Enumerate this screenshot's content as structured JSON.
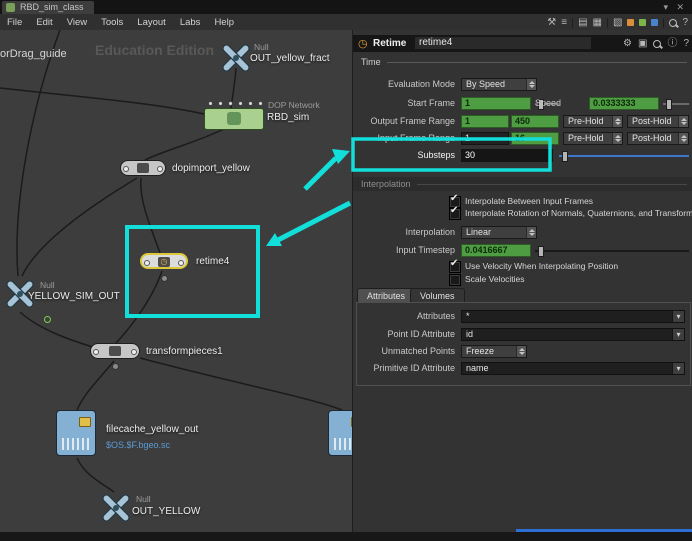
{
  "colors": {
    "highlight_cyan": "#12dfda",
    "keyframe_green": "#4f9d42",
    "slider_blue": "#3f76c9",
    "file_path_blue": "#5b9bd5",
    "dop_node_green": "#a9d08e"
  },
  "icons": {
    "clock": "◷",
    "gear": "⚙",
    "bookmark": "▣",
    "info": "ⓘ",
    "help": "?",
    "caret_down": "▾",
    "close": "✕",
    "check": "✔",
    "hammer": "⚒",
    "list": "≡",
    "grid": "▤",
    "grid2": "▦",
    "grid3": "▧"
  },
  "window": {
    "tab_title": "RBD_sim_class",
    "menus": [
      "File",
      "Edit",
      "View",
      "Tools",
      "Layout",
      "Labs",
      "Help"
    ]
  },
  "network": {
    "watermark": "Education Edition",
    "guide_label": "orDrag_guide",
    "nodes": {
      "out_yellow_fract": {
        "type": "Null",
        "name": "OUT_yellow_fract"
      },
      "rbd_sim": {
        "type": "DOP Network",
        "name": "RBD_sim"
      },
      "dopimport_yellow": {
        "name": "dopimport_yellow"
      },
      "retime": {
        "name": "retime4"
      },
      "yellow_sim_out": {
        "type": "Null",
        "name": "YELLOW_SIM_OUT"
      },
      "transformpieces": {
        "name": "transformpieces1"
      },
      "filecache": {
        "name": "filecache_yellow_out",
        "path": "$OS.$F.bgeo.sc"
      },
      "out_yellow": {
        "type": "Null",
        "name": "OUT_YELLOW"
      }
    }
  },
  "params": {
    "header": {
      "node_type": "Retime",
      "node_name": "retime4"
    },
    "time": {
      "title": "Time",
      "evaluation_mode_label": "Evaluation Mode",
      "evaluation_mode_value": "By Speed",
      "start_frame_label": "Start Frame",
      "start_frame_value": "1",
      "speed_label": "Speed",
      "speed_value": "0.0333333",
      "output_range_label": "Output Frame Range",
      "output_start": "1",
      "output_end": "450",
      "pre_hold_label": "Pre-Hold",
      "post_hold_label": "Post-Hold",
      "input_range_label": "Input Frame Range",
      "input_start": "1",
      "input_end": "16",
      "substeps_label": "Substeps",
      "substeps_value": "30"
    },
    "interpolation": {
      "title": "Interpolation",
      "interp_between": "Interpolate Between Input Frames",
      "interp_rotation": "Interpolate Rotation of Normals, Quaternions, and Transforms",
      "interpolation_label": "Interpolation",
      "interpolation_value": "Linear",
      "input_timestep_label": "Input Timestep",
      "input_timestep_value": "0.0416667",
      "use_velocity": "Use Velocity When Interpolating Position",
      "scale_velocities": "Scale Velocities"
    },
    "tabs": {
      "attributes": "Attributes",
      "volumes": "Volumes"
    },
    "attributes_tab": {
      "attributes_label": "Attributes",
      "attributes_value": "*",
      "point_id_label": "Point ID Attribute",
      "point_id_value": "id",
      "unmatched_label": "Unmatched Points",
      "unmatched_value": "Freeze",
      "primitive_id_label": "Primitive ID Attribute",
      "primitive_id_value": "name"
    }
  }
}
